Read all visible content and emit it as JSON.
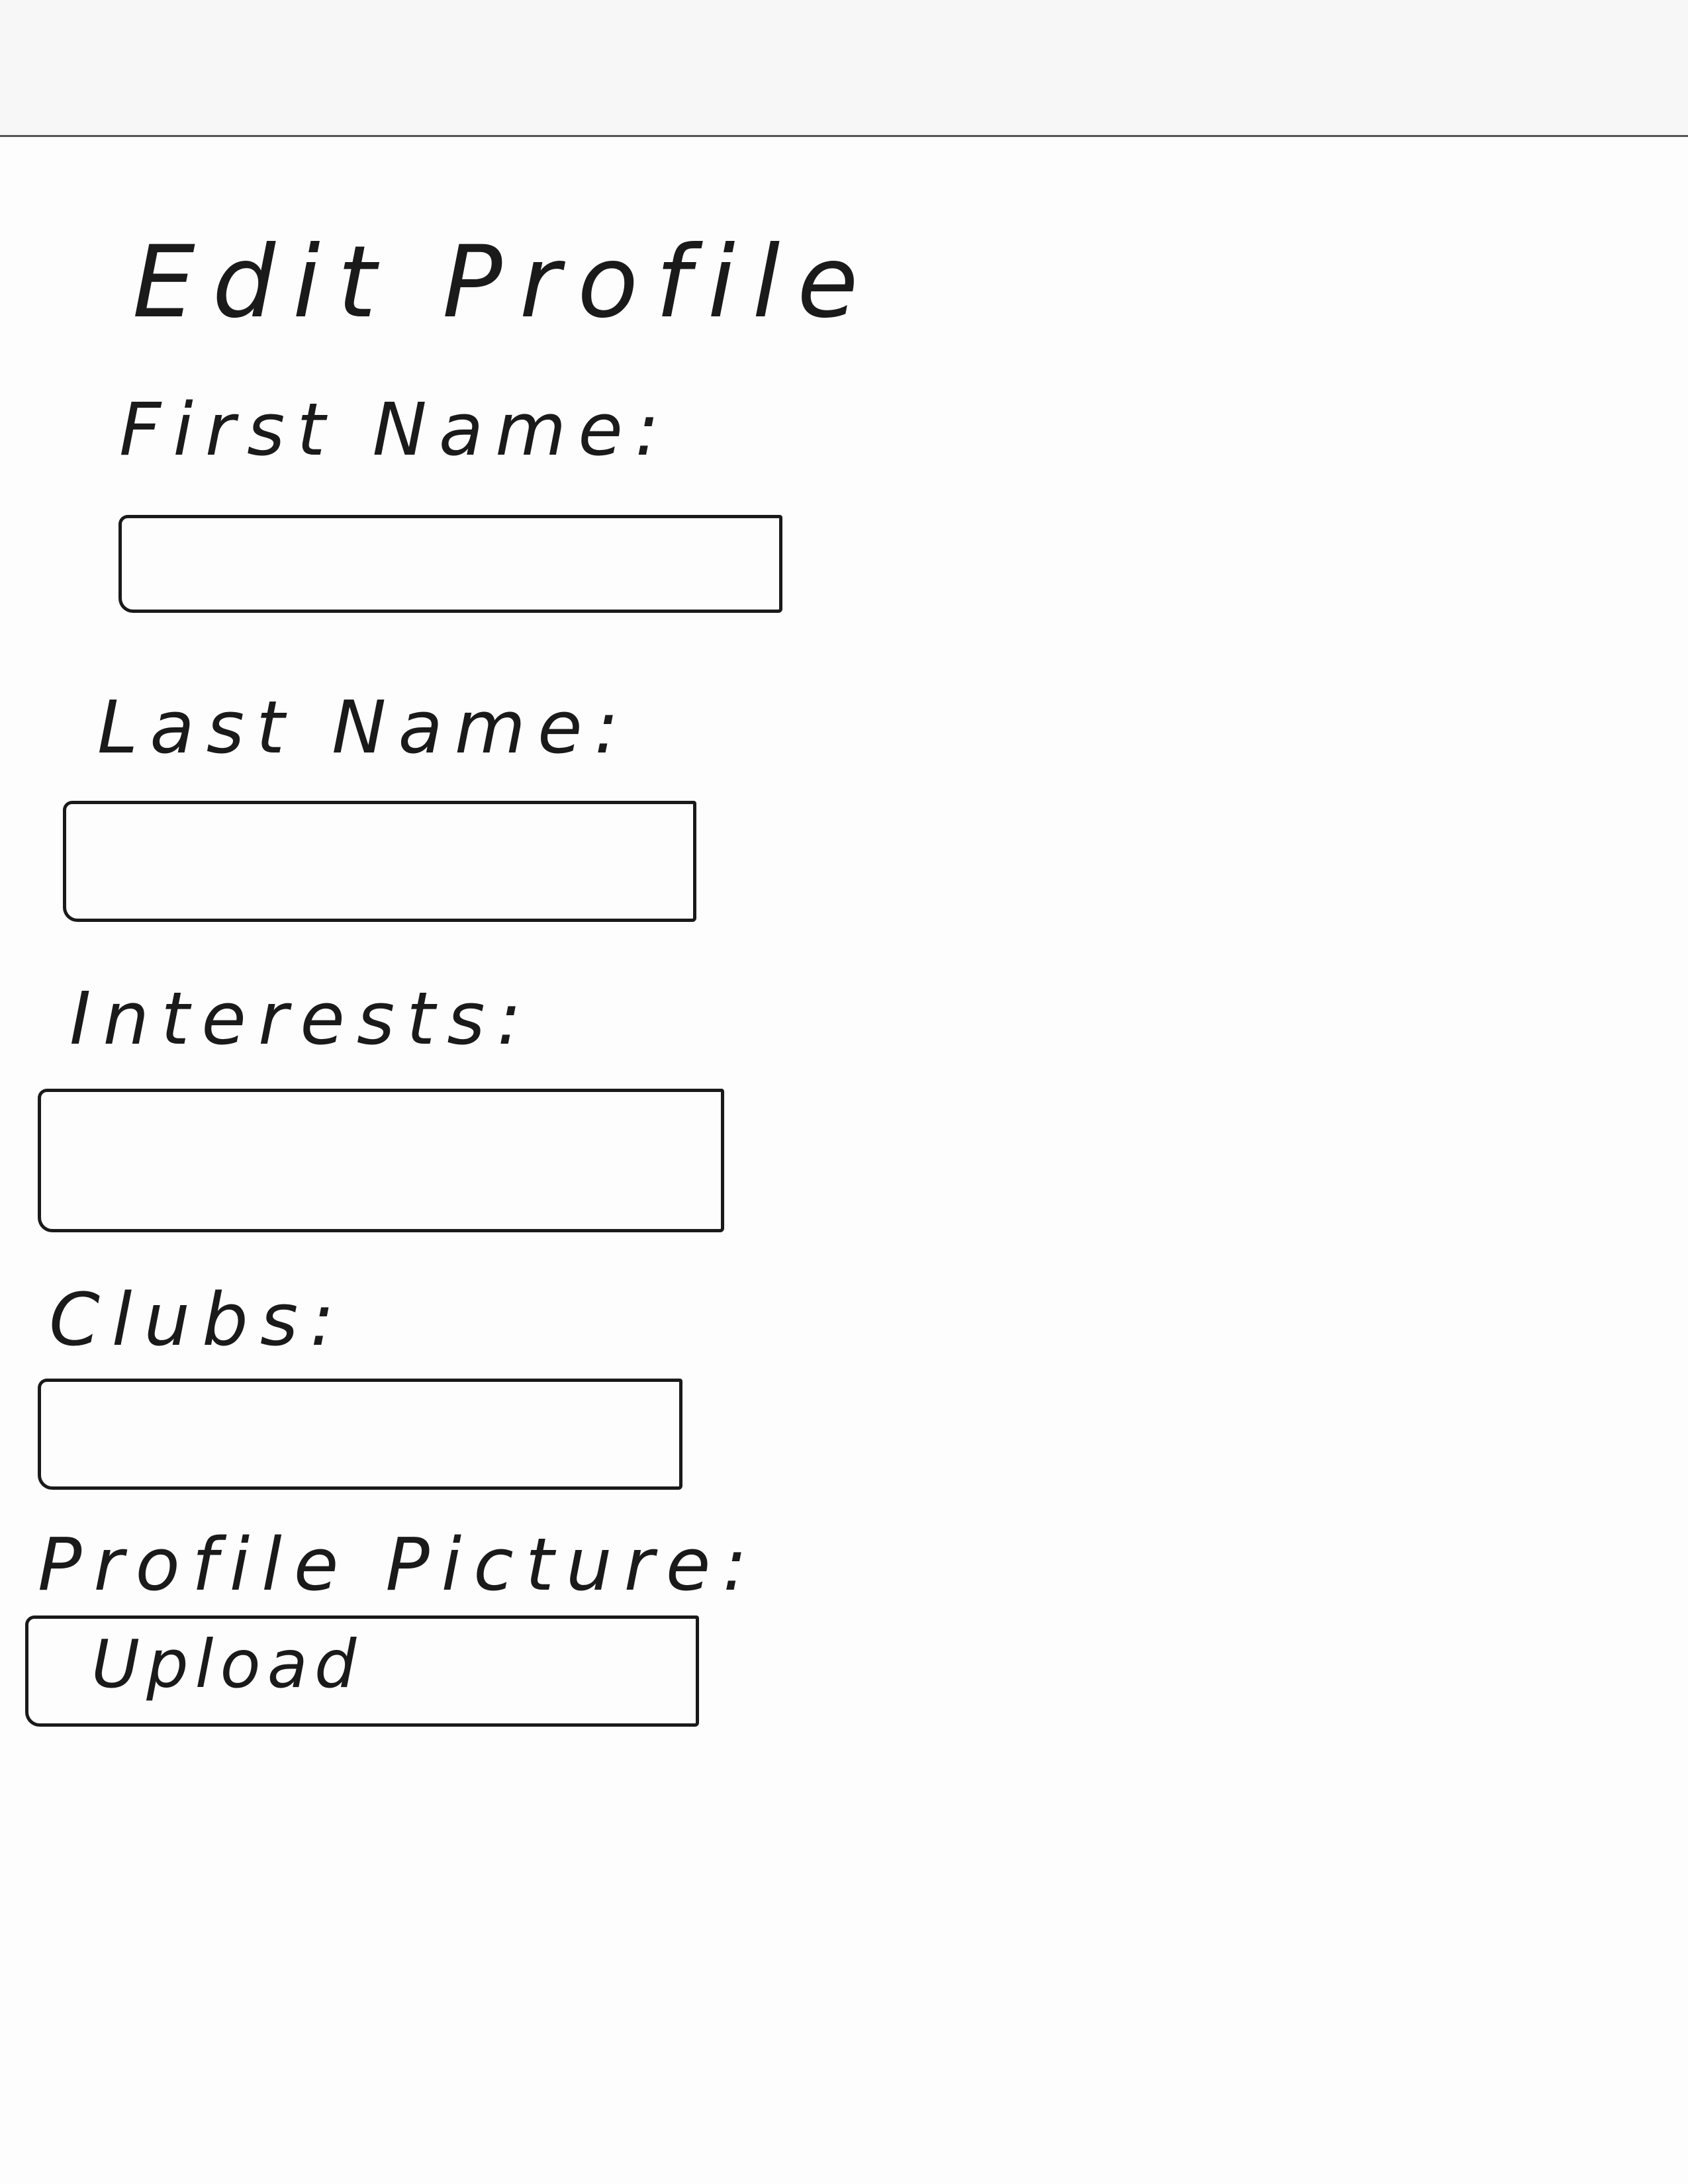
{
  "page": {
    "title": "Edit Profile"
  },
  "form": {
    "first_name": {
      "label": "First Name:",
      "value": ""
    },
    "last_name": {
      "label": "Last Name:",
      "value": ""
    },
    "interests": {
      "label": "Interests:",
      "value": ""
    },
    "clubs": {
      "label": "Clubs:",
      "value": ""
    },
    "profile_picture": {
      "label": "Profile Picture:",
      "button_label": "Upload"
    }
  }
}
